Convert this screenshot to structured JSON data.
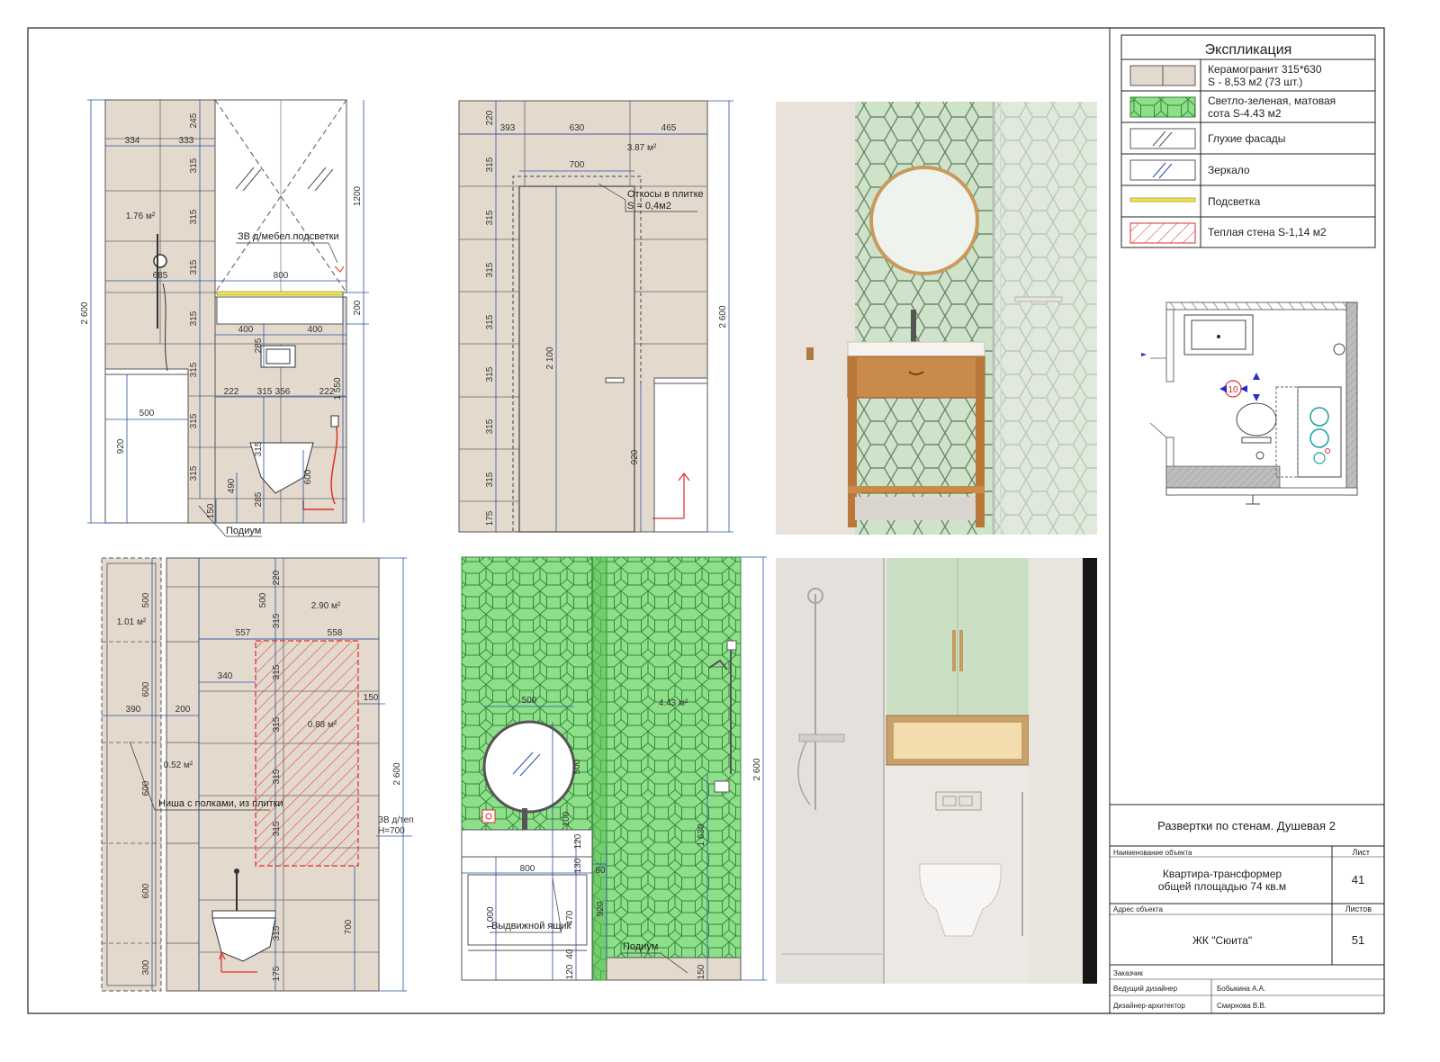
{
  "legend": {
    "title": "Экспликация",
    "items": [
      {
        "line1": "Керамогранит 315*630",
        "line2": "S - 8,53 м2 (73 шт.)"
      },
      {
        "line1": "Светло-зеленая, матовая",
        "line2": "сота S-4.43 м2"
      },
      {
        "line1": "Глухие фасады",
        "line2": ""
      },
      {
        "line1": "Зеркало",
        "line2": ""
      },
      {
        "line1": "Подсветка",
        "line2": ""
      },
      {
        "line1": "Теплая стена S-1,14 м2",
        "line2": ""
      }
    ]
  },
  "plan": {
    "marker": "10"
  },
  "titleblock": {
    "sheet_title": "Развертки по стенам. Душевая 2",
    "object_label": "Наименование объекта",
    "sheet_label": "Лист",
    "object_line1": "Квартира-трансформер",
    "object_line2": "общей площадью 74 кв.м",
    "sheet_no": "41",
    "address_label": "Адрес объекта",
    "sheets_label": "Листов",
    "address": "ЖК \"Сюита\"",
    "sheets_no": "51",
    "client_label": "Заказчик",
    "lead_label": "Ведущий дизайнер",
    "lead_name": "Бобыкина А.А.",
    "arch_label": "Дизайнер-архитектор",
    "arch_name": "Смирнова В.В."
  },
  "wall_a": {
    "height": "2 600",
    "d1200": "1200",
    "d200": "200",
    "d1550": "1 550",
    "d920": "920",
    "w334": "334",
    "w333": "333",
    "w800": "800",
    "w685": "685",
    "w400a": "400",
    "w400b": "400",
    "w222a": "222",
    "w315": "315",
    "w356": "356",
    "w222b": "222",
    "w500": "500",
    "h245": "245",
    "h315": "315",
    "h285a": "285",
    "h285b": "285",
    "h490": "490",
    "h600": "600",
    "h150": "150",
    "area": "1.76 м²",
    "note_light": "ЗВ д/мебел.подсветки",
    "podium": "Подиум"
  },
  "wall_b": {
    "height": "2 600",
    "h220": "220",
    "h315": "315",
    "h175": "175",
    "d2100": "2 100",
    "d920": "920",
    "w393": "393",
    "w630": "630",
    "w465": "465",
    "w700": "700",
    "area": "3.87 м²",
    "slopes1": "Откосы в плитке",
    "slopes2": "S = 0,4м2"
  },
  "wall_c": {
    "height": "2 600",
    "area1": "1.01 м²",
    "area2": "2.90 м²",
    "area3": "0.52 м²",
    "area4": "0.88 м²",
    "h500a": "500",
    "h600a": "600",
    "h600b": "600",
    "h600c": "600",
    "h300": "300",
    "h500b": "500",
    "h220": "220",
    "h315": "315",
    "h175": "175",
    "h700": "700",
    "w557": "557",
    "w558": "558",
    "w340": "340",
    "w390": "390",
    "w200": "200",
    "w150": "150",
    "niche": "Ниша с полками, из плитки",
    "zv1": "ЗВ д/теп",
    "zv2": "H=700"
  },
  "wall_d": {
    "height": "2 600",
    "area": "4.43 м²",
    "w500": "500",
    "h500": "500",
    "h100": "100",
    "h120a": "120",
    "h130": "130",
    "w800": "800",
    "w80": "80",
    "d1000": "1 000",
    "h470": "470",
    "h40": "40",
    "h120b": "120",
    "h920": "920",
    "d1630": "1 630",
    "h150": "150",
    "drawer": "Выдвижной ящик",
    "podium": "Подиум"
  },
  "colors": {
    "tile": "#e3dacd",
    "green_tile": "#8fdf8a",
    "green_stroke": "#2f8a3a",
    "dim": "#2a4fa8",
    "warm": "#e02b2b",
    "light": "#f2e64a",
    "line": "#444444"
  }
}
